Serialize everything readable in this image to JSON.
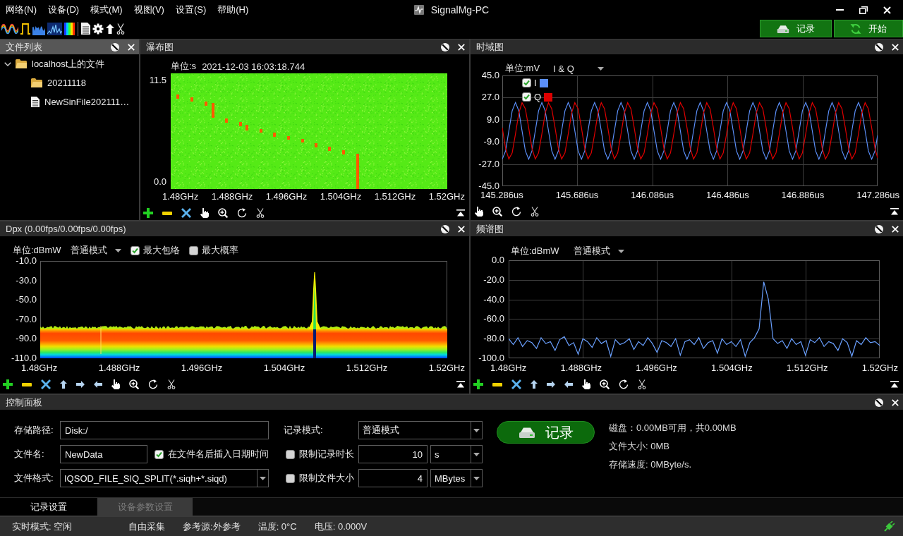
{
  "menu": [
    "网络(N)",
    "设备(D)",
    "模式(M)",
    "视图(V)",
    "设置(S)",
    "帮助(H)"
  ],
  "window": {
    "title": "SignalMg-PC"
  },
  "toolbar": {
    "buttons": [
      {
        "kind": "record",
        "label": "记录"
      },
      {
        "kind": "start",
        "label": "开始"
      }
    ]
  },
  "file_list": {
    "title": "文件列表",
    "active": true,
    "tree": [
      {
        "label": "localhost上的文件",
        "kind": "folder",
        "expanded": true,
        "children": [
          {
            "label": "20211118",
            "kind": "folder"
          },
          {
            "label": "NewSinFile202111…",
            "kind": "file"
          }
        ]
      }
    ]
  },
  "waterfall": {
    "title": "瀑布图",
    "active": false,
    "unit": "单位:s",
    "timestamp": "2021-12-03 16:03:18.744",
    "y_ticks": [
      "11.5",
      "0.0"
    ],
    "x_ticks": [
      "1.48GHz",
      "1.488GHz",
      "1.496GHz",
      "1.504GHz",
      "1.512GHz",
      "1.52GHz"
    ],
    "tools": [
      {
        "kind": "add"
      },
      {
        "kind": "remove"
      },
      {
        "kind": "clear"
      },
      {
        "kind": "pan"
      },
      {
        "kind": "zoom"
      },
      {
        "kind": "reset"
      },
      {
        "kind": "cut"
      }
    ]
  },
  "time_domain": {
    "title": "时域图",
    "active": false,
    "unit": "单位:mV",
    "mode": "I & Q",
    "legend": [
      {
        "label": "I",
        "checked": true,
        "color": "#5b8ff9"
      },
      {
        "label": "Q",
        "checked": true,
        "color": "#dd0000"
      }
    ],
    "y_ticks": [
      "45.0",
      "27.0",
      "9.0",
      "-9.0",
      "-27.0",
      "-45.0"
    ],
    "x_ticks": [
      "145.286us",
      "145.686us",
      "146.086us",
      "146.486us",
      "146.886us",
      "147.286us"
    ],
    "tools": [
      {
        "kind": "pan"
      },
      {
        "kind": "zoom"
      },
      {
        "kind": "reset"
      },
      {
        "kind": "cut"
      }
    ]
  },
  "dpx": {
    "title": "Dpx (0.00fps/0.00fps/0.00fps)",
    "active": false,
    "unit": "单位:dBmW",
    "mode": "普通模式",
    "options": [
      {
        "label": "最大包络",
        "checked": true
      },
      {
        "label": "最大概率",
        "checked": false
      }
    ],
    "y_ticks": [
      "-10.0",
      "-30.0",
      "-50.0",
      "-70.0",
      "-90.0",
      "-110.0"
    ],
    "x_ticks": [
      "1.48GHz",
      "1.488GHz",
      "1.496GHz",
      "1.504GHz",
      "1.512GHz",
      "1.52GHz"
    ],
    "tools": [
      {
        "kind": "add"
      },
      {
        "kind": "remove"
      },
      {
        "kind": "clear"
      },
      {
        "kind": "up"
      },
      {
        "kind": "right"
      },
      {
        "kind": "left"
      },
      {
        "kind": "pan"
      },
      {
        "kind": "zoom"
      },
      {
        "kind": "reset"
      },
      {
        "kind": "cut"
      }
    ]
  },
  "spectrum": {
    "title": "频谱图",
    "active": false,
    "unit": "单位:dBmW",
    "mode": "普通模式",
    "chart_data": {
      "type": "line",
      "grid": true,
      "x": [
        1.48,
        1.4805,
        1.481,
        1.4815,
        1.482,
        1.4825,
        1.483,
        1.4835,
        1.484,
        1.4845,
        1.485,
        1.4855,
        1.486,
        1.4865,
        1.487,
        1.4875,
        1.488,
        1.4885,
        1.489,
        1.4895,
        1.49,
        1.4905,
        1.491,
        1.4915,
        1.492,
        1.4925,
        1.493,
        1.4935,
        1.494,
        1.4945,
        1.495,
        1.4955,
        1.496,
        1.4965,
        1.497,
        1.4975,
        1.498,
        1.4985,
        1.499,
        1.4995,
        1.5,
        1.5005,
        1.501,
        1.5015,
        1.502,
        1.5025,
        1.503,
        1.5035,
        1.504,
        1.5045,
        1.505,
        1.5055,
        1.506,
        1.5065,
        1.507,
        1.5075,
        1.508,
        1.5085,
        1.509,
        1.5095,
        1.51,
        1.5105,
        1.511,
        1.5115,
        1.512,
        1.5125,
        1.513,
        1.5135,
        1.514,
        1.5145,
        1.515,
        1.5155,
        1.516,
        1.5165,
        1.517,
        1.5175,
        1.518,
        1.5185,
        1.519,
        1.5195,
        1.52
      ],
      "xlim": [
        1.48,
        1.52
      ],
      "ylim": [
        -100,
        0
      ],
      "xticks": [
        {
          "value": 1.48,
          "label": "1.48GHz"
        },
        {
          "value": 1.488,
          "label": "1.488GHz"
        },
        {
          "value": 1.496,
          "label": "1.496GHz"
        },
        {
          "value": 1.504,
          "label": "1.504GHz"
        },
        {
          "value": 1.512,
          "label": "1.512GHz"
        },
        {
          "value": 1.52,
          "label": "1.52GHz"
        }
      ],
      "yticks": [
        {
          "value": 0,
          "label": "0.0"
        },
        {
          "value": -20,
          "label": "-20.0"
        },
        {
          "value": -40,
          "label": "-40.0"
        },
        {
          "value": -60,
          "label": "-60.0"
        },
        {
          "value": -80,
          "label": "-80.0"
        },
        {
          "value": -100,
          "label": "-100.0"
        }
      ],
      "series": [
        {
          "color": "#6aa0ff",
          "values": [
            -80,
            -86,
            -79,
            -88,
            -82,
            -84,
            -90,
            -79,
            -85,
            -83,
            -92,
            -81,
            -78,
            -87,
            -84,
            -96,
            -80,
            -83,
            -89,
            -79,
            -85,
            -82,
            -98,
            -81,
            -86,
            -84,
            -80,
            -91,
            -83,
            -87,
            -79,
            -85,
            -94,
            -82,
            -84,
            -88,
            -80,
            -97,
            -83,
            -81,
            -86,
            -79,
            -90,
            -84,
            -82,
            -95,
            -80,
            -86,
            -83,
            -88,
            -81,
            -98,
            -84,
            -79,
            -70,
            -22,
            -40,
            -80,
            -85,
            -82,
            -90,
            -80,
            -86,
            -83,
            -97,
            -81,
            -84,
            -79,
            -88,
            -83,
            -85,
            -92,
            -80,
            -84,
            -98,
            -82,
            -86,
            -79,
            -84,
            -83,
            -87
          ]
        }
      ]
    },
    "tools": [
      {
        "kind": "add"
      },
      {
        "kind": "remove"
      },
      {
        "kind": "clear"
      },
      {
        "kind": "up"
      },
      {
        "kind": "right"
      },
      {
        "kind": "left"
      },
      {
        "kind": "pan"
      },
      {
        "kind": "zoom"
      },
      {
        "kind": "reset"
      },
      {
        "kind": "cut"
      }
    ]
  },
  "control_panel": {
    "title": "控制面板",
    "active": false,
    "storage_path": {
      "label": "存储路径:",
      "value": "Disk:/"
    },
    "file_name": {
      "label": "文件名:",
      "value": "NewData"
    },
    "append_datetime": {
      "label": "在文件名后插入日期时间",
      "checked": true
    },
    "file_format": {
      "label": "文件格式:",
      "value": "IQSOD_FILE_SIQ_SPLIT(*.siqh+*.siqd)"
    },
    "record_mode": {
      "label": "记录模式:",
      "value": "普通模式"
    },
    "limit_duration": {
      "label": "限制记录时长",
      "checked": false,
      "value": "10",
      "unit": "s"
    },
    "limit_size": {
      "label": "限制文件大小",
      "checked": false,
      "value": "4",
      "unit": "MBytes"
    },
    "record_button": {
      "label": "记录"
    },
    "info": [
      "磁盘：0.00MB可用，共0.00MB",
      "文件大小: 0MB",
      "存储速度: 0MByte/s."
    ]
  },
  "tabs": [
    {
      "label": "记录设置",
      "selected": true
    },
    {
      "label": "设备参数设置",
      "selected": false
    }
  ],
  "status_bar": [
    "实时模式: 空闲",
    "自由采集",
    "参考源:外参考",
    "温度: 0°C",
    "电压: 0.000V"
  ]
}
